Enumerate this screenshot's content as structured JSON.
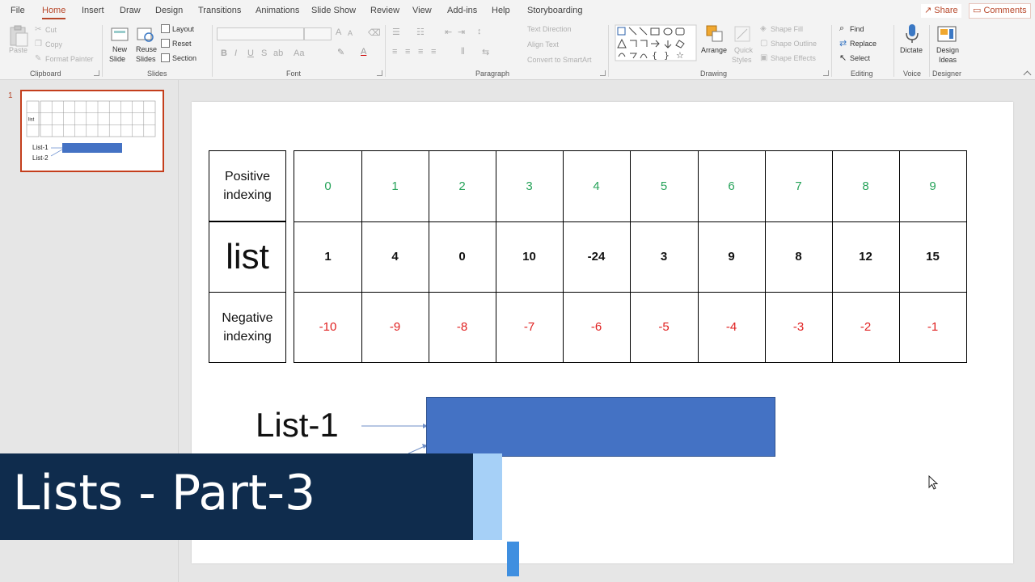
{
  "ribbon_tabs": [
    "File",
    "Home",
    "Insert",
    "Draw",
    "Design",
    "Transitions",
    "Animations",
    "Slide Show",
    "Review",
    "View",
    "Add-ins",
    "Help",
    "Storyboarding"
  ],
  "share_label": "Share",
  "comments_label": "Comments",
  "clipboard": {
    "paste": "Paste",
    "cut": "Cut",
    "copy": "Copy",
    "format_painter": "Format Painter",
    "label": "Clipboard"
  },
  "slides_group": {
    "new_slide_1": "New",
    "new_slide_2": "Slide",
    "reuse_1": "Reuse",
    "reuse_2": "Slides",
    "layout": "Layout",
    "reset": "Reset",
    "section": "Section",
    "label": "Slides"
  },
  "font_group": {
    "label": "Font",
    "bold": "B",
    "italic": "I",
    "underline": "U",
    "strike": "S",
    "spacing": "ab",
    "case": "Aa",
    "grow": "A",
    "shrink": "A"
  },
  "paragraph_group": {
    "text_direction": "Text Direction",
    "align_text": "Align Text",
    "smartart": "Convert to SmartArt",
    "label": "Paragraph"
  },
  "drawing_group": {
    "arrange": "Arrange",
    "quick_styles_1": "Quick",
    "quick_styles_2": "Styles",
    "shape_fill": "Shape Fill",
    "shape_outline": "Shape Outline",
    "shape_effects": "Shape Effects",
    "label": "Drawing"
  },
  "editing_group": {
    "find": "Find",
    "replace": "Replace",
    "select": "Select",
    "label": "Editing"
  },
  "voice_group": {
    "dictate": "Dictate",
    "label": "Voice"
  },
  "designer_group": {
    "design_ideas_1": "Design",
    "design_ideas_2": "Ideas",
    "label": "Designer"
  },
  "thumbnail": {
    "number": "1",
    "list1": "List-1",
    "list2": "List-2"
  },
  "slide": {
    "row_labels": {
      "positive": "Positive\nindexing",
      "list": "list",
      "negative": "Negative\nindexing"
    },
    "positive_indices": [
      "0",
      "1",
      "2",
      "3",
      "4",
      "5",
      "6",
      "7",
      "8",
      "9"
    ],
    "list_values": [
      "1",
      "4",
      "0",
      "10",
      "-24",
      "3",
      "9",
      "8",
      "12",
      "15"
    ],
    "negative_indices": [
      "-10",
      "-9",
      "-8",
      "-7",
      "-6",
      "-5",
      "-4",
      "-3",
      "-2",
      "-1"
    ],
    "list1_label": "List-1"
  },
  "banner": {
    "title": "Lists - Part-3"
  },
  "colors": {
    "accent": "#b7472a",
    "positive": "#27a35a",
    "negative": "#e02020",
    "shape_blue": "#4472c4",
    "banner_bg": "#0f2c4d",
    "banner_accent": "#a6d0f7"
  }
}
